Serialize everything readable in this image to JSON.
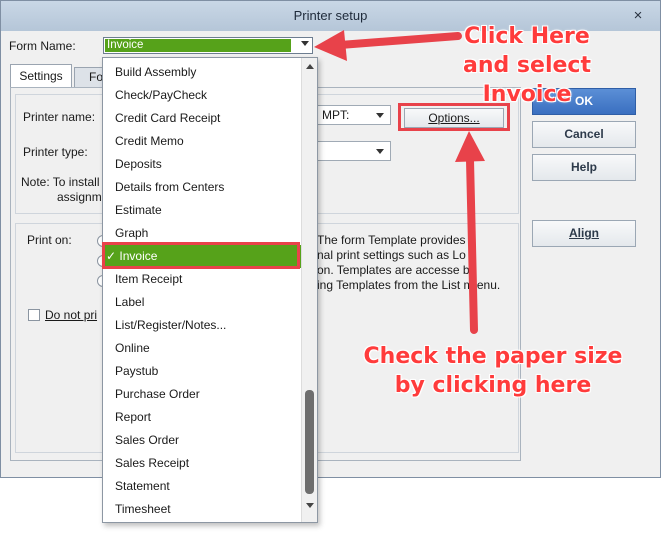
{
  "window": {
    "title": "Printer setup",
    "close_glyph": "×"
  },
  "form_name": {
    "label": "Form Name:",
    "value": "Invoice"
  },
  "tabs": {
    "settings": "Settings",
    "fonts": "Fo"
  },
  "printer": {
    "name_label": "Printer name:",
    "name_value": "MPT:",
    "type_label": "Printer type:",
    "note": "Note: To install",
    "note2": "assignm",
    "options_button": "Options..."
  },
  "print_on": {
    "label": "Print on:",
    "description": [
      "The form Template provides",
      "nal print settings such as Lo   o",
      "on.  Templates are accesse   by",
      "ing Templates from the List m  enu."
    ],
    "do_not_print": "Do not pri"
  },
  "buttons": {
    "ok": "OK",
    "cancel": "Cancel",
    "help": "Help",
    "align": "Align"
  },
  "dropdown": {
    "items": [
      "Build Assembly",
      "Check/PayCheck",
      "Credit Card Receipt",
      "Credit Memo",
      "Deposits",
      "Details from Centers",
      "Estimate",
      "Graph",
      "✓ Invoice",
      "Item Receipt",
      "Label",
      "List/Register/Notes...",
      "Online",
      "Paystub",
      "Purchase Order",
      "Report",
      "Sales Order",
      "Sales Receipt",
      "Statement",
      "Timesheet"
    ],
    "selected": "Invoice"
  },
  "annotations": {
    "click_here": [
      "Click Here",
      "and select",
      "Invoice"
    ],
    "paper_size": [
      "Check the paper size",
      "by clicking here"
    ]
  },
  "colors": {
    "annotation": "#ff3b3b",
    "selection": "#56a21a",
    "ok_button": "#3a6fc0"
  }
}
